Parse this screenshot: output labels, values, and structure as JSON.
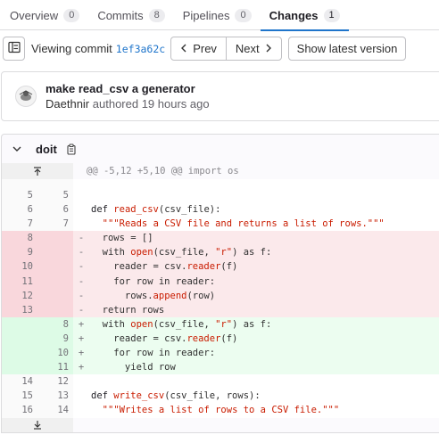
{
  "tabs": [
    {
      "label": "Overview",
      "count": "0"
    },
    {
      "label": "Commits",
      "count": "8"
    },
    {
      "label": "Pipelines",
      "count": "0"
    },
    {
      "label": "Changes",
      "count": "1",
      "active": true
    }
  ],
  "commit_nav": {
    "viewing_label": "Viewing commit",
    "sha": "1ef3a62c",
    "prev_label": "Prev",
    "next_label": "Next",
    "latest_label": "Show latest version"
  },
  "commit": {
    "title": "make read_csv a generator",
    "author": "Daethnir",
    "meta": "authored 19 hours ago"
  },
  "file": {
    "name": "doit"
  },
  "hunk_header": "@@ -5,12 +5,10 @@ import os",
  "diff_lines": [
    {
      "type": "ctx",
      "old": "5",
      "new": "5",
      "code": ""
    },
    {
      "type": "ctx",
      "old": "6",
      "new": "6",
      "code": "def read_csv(csv_file):"
    },
    {
      "type": "ctx",
      "old": "7",
      "new": "7",
      "code": "  \"\"\"Reads a CSV file and returns a list of rows.\"\"\""
    },
    {
      "type": "del",
      "old": "8",
      "new": "",
      "code": "  rows = []"
    },
    {
      "type": "del",
      "old": "9",
      "new": "",
      "code": "  with open(csv_file, \"r\") as f:"
    },
    {
      "type": "del",
      "old": "10",
      "new": "",
      "code": "    reader = csv.reader(f)"
    },
    {
      "type": "del",
      "old": "11",
      "new": "",
      "code": "    for row in reader:"
    },
    {
      "type": "del",
      "old": "12",
      "new": "",
      "code": "      rows.append(row)"
    },
    {
      "type": "del",
      "old": "13",
      "new": "",
      "code": "  return rows"
    },
    {
      "type": "add",
      "old": "",
      "new": "8",
      "code": "  with open(csv_file, \"r\") as f:"
    },
    {
      "type": "add",
      "old": "",
      "new": "9",
      "code": "    reader = csv.reader(f)"
    },
    {
      "type": "add",
      "old": "",
      "new": "10",
      "code": "    for row in reader:"
    },
    {
      "type": "add",
      "old": "",
      "new": "11",
      "code": "      yield row"
    },
    {
      "type": "ctx",
      "old": "14",
      "new": "12",
      "code": ""
    },
    {
      "type": "ctx",
      "old": "15",
      "new": "13",
      "code": "def write_csv(csv_file, rows):"
    },
    {
      "type": "ctx",
      "old": "16",
      "new": "14",
      "code": "  \"\"\"Writes a list of rows to a CSV file.\"\"\""
    }
  ],
  "colors": {
    "accent": "#1f75cb",
    "deleted_bg": "#fbe9eb",
    "added_bg": "#ecfdf0",
    "syntax_red": "#c91c00"
  }
}
